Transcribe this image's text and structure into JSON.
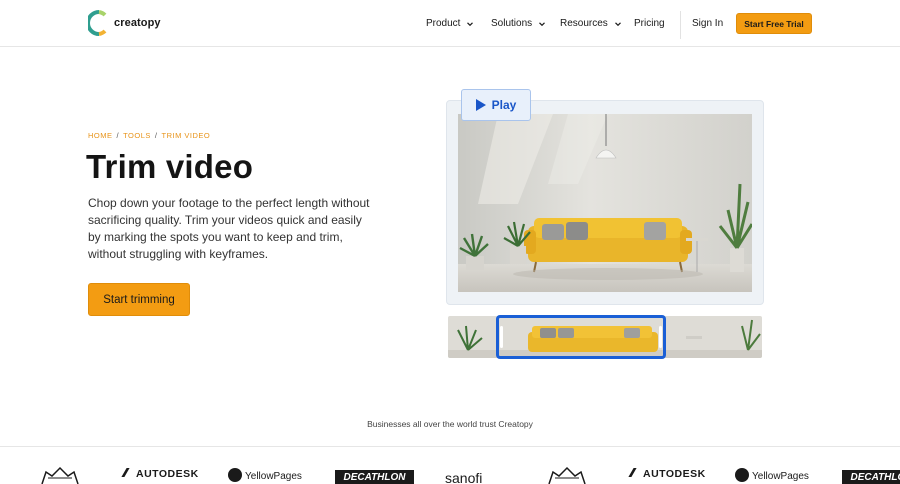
{
  "header": {
    "logo_text": "creatopy",
    "nav": [
      {
        "label": "Product",
        "has_dropdown": true
      },
      {
        "label": "Solutions",
        "has_dropdown": true
      },
      {
        "label": "Resources",
        "has_dropdown": true
      },
      {
        "label": "Pricing",
        "has_dropdown": false
      }
    ],
    "sign_in": "Sign In",
    "cta": "Start Free Trial"
  },
  "breadcrumb": [
    "HOME",
    "TOOLS",
    "TRIM VIDEO"
  ],
  "breadcrumb_separator": "/",
  "hero": {
    "title": "Trim video",
    "description": "Chop down your footage to the perfect length without sacrificing quality. Trim your videos quick and easily by marking the spots you want to keep and trim, without struggling with keyframes.",
    "cta": "Start trimming",
    "play_label": "Play"
  },
  "trust": {
    "text": "Businesses all over the world trust Creatopy",
    "brands": [
      "AUTODESK",
      "YellowPages",
      "DECATHLON",
      "sanofi",
      "AUTODESK",
      "YellowPages",
      "DECATHLON"
    ]
  },
  "colors": {
    "accent": "#f39c12",
    "breadcrumb": "#e8941a",
    "trim_blue": "#1a5fd6"
  }
}
